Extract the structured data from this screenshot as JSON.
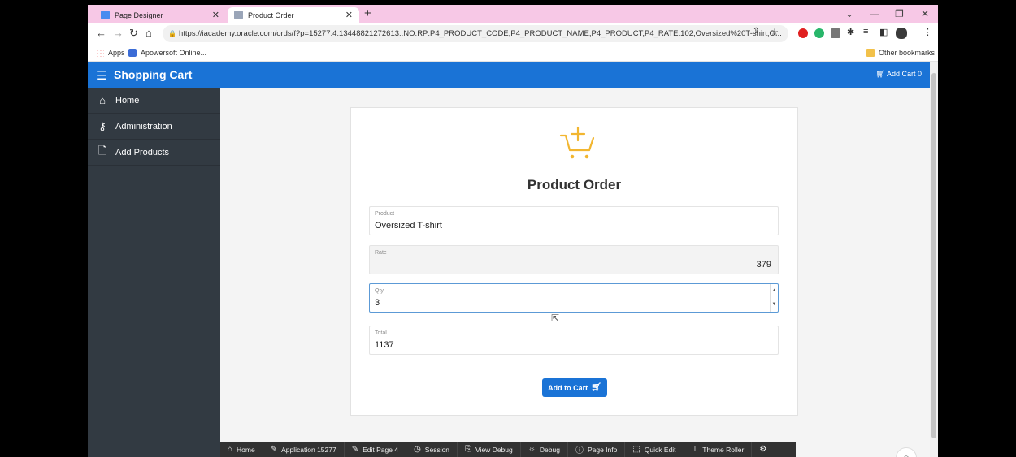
{
  "browser": {
    "tabs": [
      {
        "label": "Page Designer",
        "color": "#4a8cf0"
      },
      {
        "label": "Product Order",
        "color": "#9aa5b8"
      }
    ],
    "url": "https://iacademy.oracle.com/ords/f?p=15277:4:13448821272613::NO:RP:P4_PRODUCT_CODE,P4_PRODUCT_NAME,P4_PRODUCT,P4_RATE:102,Oversized%20T-shirt,O...",
    "bookmarks": {
      "apps": "Apps",
      "apowersoft": "Apowersoft Online...",
      "other": "Other bookmarks"
    }
  },
  "app": {
    "title": "Shopping Cart",
    "add_cart": "Add Cart 0",
    "accent": "#1a73d6"
  },
  "sidebar": {
    "items": [
      {
        "label": "Home",
        "icon": "home-icon"
      },
      {
        "label": "Administration",
        "icon": "user-key-icon"
      },
      {
        "label": "Add Products",
        "icon": "file-icon"
      }
    ]
  },
  "form": {
    "title": "Product Order",
    "product": {
      "label": "Product",
      "value": "Oversized T-shirt"
    },
    "rate": {
      "label": "Rate",
      "value": "379"
    },
    "qty": {
      "label": "Qty",
      "value": "3"
    },
    "total": {
      "label": "Total",
      "value": "1137"
    },
    "add_button": "Add to Cart"
  },
  "devbar": {
    "items": [
      {
        "label": "Home",
        "icon": "home-icon"
      },
      {
        "label": "Application 15277",
        "icon": "edit-app-icon"
      },
      {
        "label": "Edit Page 4",
        "icon": "edit-page-icon"
      },
      {
        "label": "Session",
        "icon": "clock-icon"
      },
      {
        "label": "View Debug",
        "icon": "view-debug-icon"
      },
      {
        "label": "Debug",
        "icon": "bug-icon"
      },
      {
        "label": "Page Info",
        "icon": "info-icon"
      },
      {
        "label": "Quick Edit",
        "icon": "quick-edit-icon"
      },
      {
        "label": "Theme Roller",
        "icon": "paint-roller-icon"
      }
    ]
  }
}
